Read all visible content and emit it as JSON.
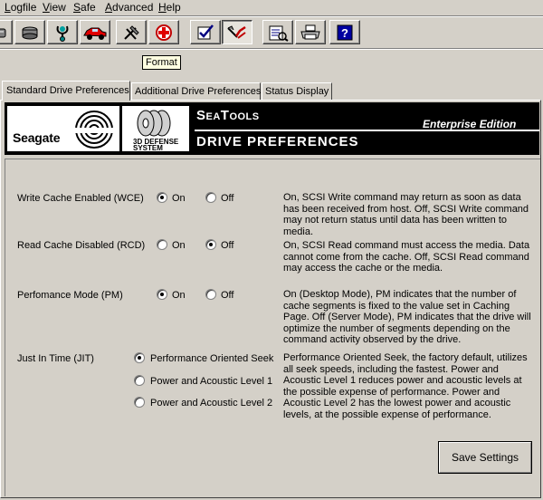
{
  "menu": {
    "items": [
      {
        "label": "Logfile",
        "accel": "L",
        "rest": "ogfile"
      },
      {
        "label": "View",
        "accel": "V",
        "rest": "iew"
      },
      {
        "label": "Safe",
        "accel": "S",
        "rest": "afe"
      },
      {
        "label": "Advanced",
        "accel": "A",
        "rest": "dvanced"
      },
      {
        "label": "Help",
        "accel": "H",
        "rest": "elp"
      }
    ]
  },
  "toolbar": {
    "buttons": [
      {
        "icon": "drive-icon"
      },
      {
        "icon": "disk-stack-icon"
      },
      {
        "icon": "stethoscope-icon"
      },
      {
        "icon": "car-icon"
      },
      {
        "icon": "hammer-icon"
      },
      {
        "icon": "first-aid-icon"
      },
      {
        "icon": "checklist-icon"
      },
      {
        "icon": "format-icon",
        "pressed": true
      },
      {
        "icon": "log-icon"
      },
      {
        "icon": "printer-icon"
      },
      {
        "icon": "help-icon"
      }
    ],
    "tooltip": "Format"
  },
  "tabs": [
    {
      "label": "Standard Drive Preferences",
      "active": true
    },
    {
      "label": "Additional Drive Preferences",
      "active": false
    },
    {
      "label": "Status Display",
      "active": false
    }
  ],
  "banner": {
    "brand": "Seagate",
    "defense_line1": "3D DEFENSE",
    "defense_line2": "SYSTEM",
    "product": "SeaTools",
    "edition": "Enterprise Edition",
    "heading": "DRIVE PREFERENCES"
  },
  "settings": {
    "wce": {
      "label": "Write Cache Enabled (WCE)",
      "options": [
        "On",
        "Off"
      ],
      "selected": "On",
      "description": "On, SCSI Write command may return as soon as data has been received from host.  Off, SCSI Write command may not return status until data has been written to media."
    },
    "rcd": {
      "label": "Read Cache Disabled (RCD)",
      "options": [
        "On",
        "Off"
      ],
      "selected": "Off",
      "description": "On, SCSI Read command must access the media.  Data cannot come from the cache.  Off, SCSI Read command may access the cache or the media."
    },
    "pm": {
      "label": "Perfomance Mode (PM)",
      "options": [
        "On",
        "Off"
      ],
      "selected": "On",
      "description": "On (Desktop Mode), PM indicates that the number of cache segments is fixed to the value set in Caching Page.  Off (Server Mode), PM indicates that the drive will optimize the number of segments depending on the command activity observed by the drive."
    },
    "jit": {
      "label": "Just In Time (JIT)",
      "options": [
        "Performance Oriented Seek",
        "Power and Acoustic Level 1",
        "Power and Acoustic Level 2"
      ],
      "selected": "Performance Oriented Seek",
      "description": "Performance Oriented Seek, the factory default, utilizes all seek speeds, including the fastest.  Power and Acoustic Level 1 reduces power and acoustic levels at the possible expense of performance.  Power and Acoustic Level 2 has the lowest power and acoustic levels, at the possible expense of performance."
    }
  },
  "save_button": "Save Settings"
}
